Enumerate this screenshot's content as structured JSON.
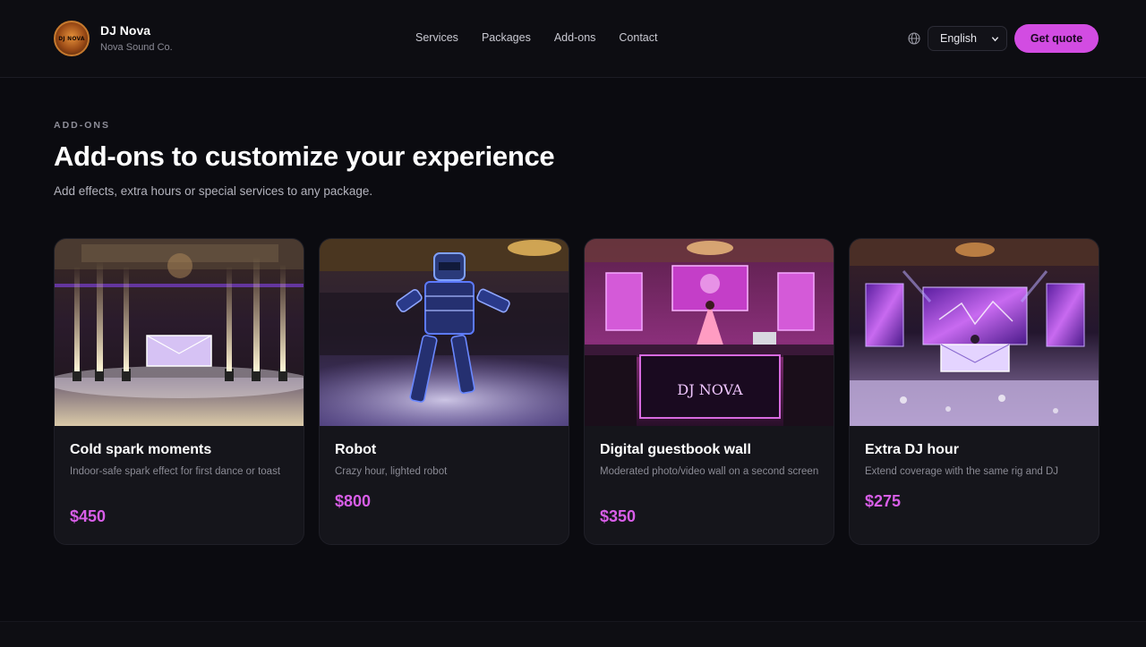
{
  "header": {
    "logo_text": "DJ NOVA",
    "brand_name": "DJ Nova",
    "brand_sub": "Nova Sound Co.",
    "nav": [
      "Services",
      "Packages",
      "Add-ons",
      "Contact"
    ],
    "language": "English",
    "cta": "Get quote"
  },
  "section": {
    "eyebrow": "ADD-ONS",
    "title": "Add-ons to customize your experience",
    "subtitle": "Add effects, extra hours or special services to any package."
  },
  "cards": [
    {
      "title": "Cold spark moments",
      "desc": "Indoor-safe spark effect for first dance or toast",
      "price": "$450",
      "image_icon": "cold-spark-photo"
    },
    {
      "title": "Robot",
      "desc": "Crazy hour, lighted robot",
      "price": "$800",
      "image_icon": "led-robot-photo"
    },
    {
      "title": "Digital guestbook wall",
      "desc": "Moderated photo/video wall on a second screen",
      "price": "$350",
      "image_icon": "guestbook-wall-photo",
      "booth_text": "DJ NOVA"
    },
    {
      "title": "Extra DJ hour",
      "desc": "Extend coverage with the same rig and DJ",
      "price": "$275",
      "image_icon": "dj-stage-photo"
    }
  ],
  "colors": {
    "accent": "#d24ce2",
    "price": "#d85ee8",
    "background": "#0b0b10",
    "card": "#15151b"
  }
}
